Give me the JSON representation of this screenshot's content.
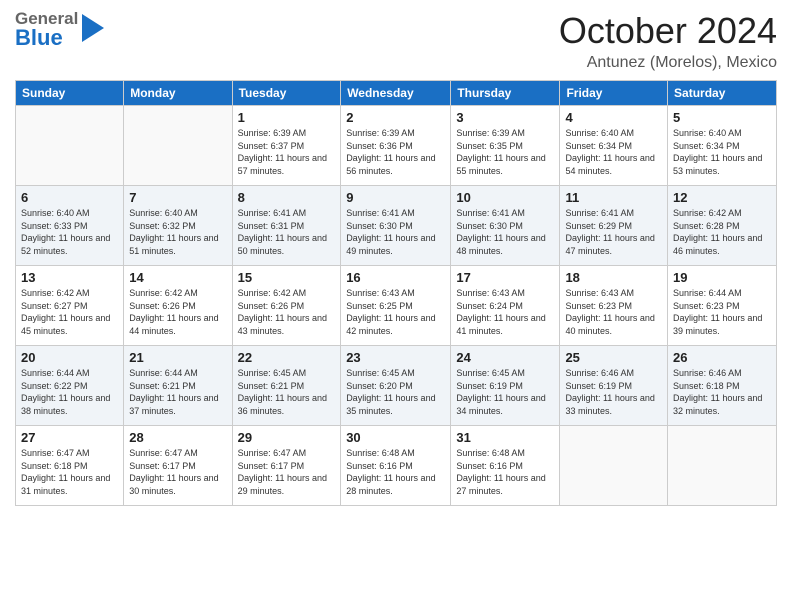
{
  "header": {
    "logo_general": "General",
    "logo_blue": "Blue",
    "month_year": "October 2024",
    "location": "Antunez (Morelos), Mexico"
  },
  "days_of_week": [
    "Sunday",
    "Monday",
    "Tuesday",
    "Wednesday",
    "Thursday",
    "Friday",
    "Saturday"
  ],
  "weeks": [
    [
      {
        "day": "",
        "info": ""
      },
      {
        "day": "",
        "info": ""
      },
      {
        "day": "1",
        "info": "Sunrise: 6:39 AM\nSunset: 6:37 PM\nDaylight: 11 hours and 57 minutes."
      },
      {
        "day": "2",
        "info": "Sunrise: 6:39 AM\nSunset: 6:36 PM\nDaylight: 11 hours and 56 minutes."
      },
      {
        "day": "3",
        "info": "Sunrise: 6:39 AM\nSunset: 6:35 PM\nDaylight: 11 hours and 55 minutes."
      },
      {
        "day": "4",
        "info": "Sunrise: 6:40 AM\nSunset: 6:34 PM\nDaylight: 11 hours and 54 minutes."
      },
      {
        "day": "5",
        "info": "Sunrise: 6:40 AM\nSunset: 6:34 PM\nDaylight: 11 hours and 53 minutes."
      }
    ],
    [
      {
        "day": "6",
        "info": "Sunrise: 6:40 AM\nSunset: 6:33 PM\nDaylight: 11 hours and 52 minutes."
      },
      {
        "day": "7",
        "info": "Sunrise: 6:40 AM\nSunset: 6:32 PM\nDaylight: 11 hours and 51 minutes."
      },
      {
        "day": "8",
        "info": "Sunrise: 6:41 AM\nSunset: 6:31 PM\nDaylight: 11 hours and 50 minutes."
      },
      {
        "day": "9",
        "info": "Sunrise: 6:41 AM\nSunset: 6:30 PM\nDaylight: 11 hours and 49 minutes."
      },
      {
        "day": "10",
        "info": "Sunrise: 6:41 AM\nSunset: 6:30 PM\nDaylight: 11 hours and 48 minutes."
      },
      {
        "day": "11",
        "info": "Sunrise: 6:41 AM\nSunset: 6:29 PM\nDaylight: 11 hours and 47 minutes."
      },
      {
        "day": "12",
        "info": "Sunrise: 6:42 AM\nSunset: 6:28 PM\nDaylight: 11 hours and 46 minutes."
      }
    ],
    [
      {
        "day": "13",
        "info": "Sunrise: 6:42 AM\nSunset: 6:27 PM\nDaylight: 11 hours and 45 minutes."
      },
      {
        "day": "14",
        "info": "Sunrise: 6:42 AM\nSunset: 6:26 PM\nDaylight: 11 hours and 44 minutes."
      },
      {
        "day": "15",
        "info": "Sunrise: 6:42 AM\nSunset: 6:26 PM\nDaylight: 11 hours and 43 minutes."
      },
      {
        "day": "16",
        "info": "Sunrise: 6:43 AM\nSunset: 6:25 PM\nDaylight: 11 hours and 42 minutes."
      },
      {
        "day": "17",
        "info": "Sunrise: 6:43 AM\nSunset: 6:24 PM\nDaylight: 11 hours and 41 minutes."
      },
      {
        "day": "18",
        "info": "Sunrise: 6:43 AM\nSunset: 6:23 PM\nDaylight: 11 hours and 40 minutes."
      },
      {
        "day": "19",
        "info": "Sunrise: 6:44 AM\nSunset: 6:23 PM\nDaylight: 11 hours and 39 minutes."
      }
    ],
    [
      {
        "day": "20",
        "info": "Sunrise: 6:44 AM\nSunset: 6:22 PM\nDaylight: 11 hours and 38 minutes."
      },
      {
        "day": "21",
        "info": "Sunrise: 6:44 AM\nSunset: 6:21 PM\nDaylight: 11 hours and 37 minutes."
      },
      {
        "day": "22",
        "info": "Sunrise: 6:45 AM\nSunset: 6:21 PM\nDaylight: 11 hours and 36 minutes."
      },
      {
        "day": "23",
        "info": "Sunrise: 6:45 AM\nSunset: 6:20 PM\nDaylight: 11 hours and 35 minutes."
      },
      {
        "day": "24",
        "info": "Sunrise: 6:45 AM\nSunset: 6:19 PM\nDaylight: 11 hours and 34 minutes."
      },
      {
        "day": "25",
        "info": "Sunrise: 6:46 AM\nSunset: 6:19 PM\nDaylight: 11 hours and 33 minutes."
      },
      {
        "day": "26",
        "info": "Sunrise: 6:46 AM\nSunset: 6:18 PM\nDaylight: 11 hours and 32 minutes."
      }
    ],
    [
      {
        "day": "27",
        "info": "Sunrise: 6:47 AM\nSunset: 6:18 PM\nDaylight: 11 hours and 31 minutes."
      },
      {
        "day": "28",
        "info": "Sunrise: 6:47 AM\nSunset: 6:17 PM\nDaylight: 11 hours and 30 minutes."
      },
      {
        "day": "29",
        "info": "Sunrise: 6:47 AM\nSunset: 6:17 PM\nDaylight: 11 hours and 29 minutes."
      },
      {
        "day": "30",
        "info": "Sunrise: 6:48 AM\nSunset: 6:16 PM\nDaylight: 11 hours and 28 minutes."
      },
      {
        "day": "31",
        "info": "Sunrise: 6:48 AM\nSunset: 6:16 PM\nDaylight: 11 hours and 27 minutes."
      },
      {
        "day": "",
        "info": ""
      },
      {
        "day": "",
        "info": ""
      }
    ]
  ],
  "colors": {
    "header_bg": "#1a6fc4",
    "header_text": "#ffffff",
    "accent": "#1a6fc4"
  }
}
